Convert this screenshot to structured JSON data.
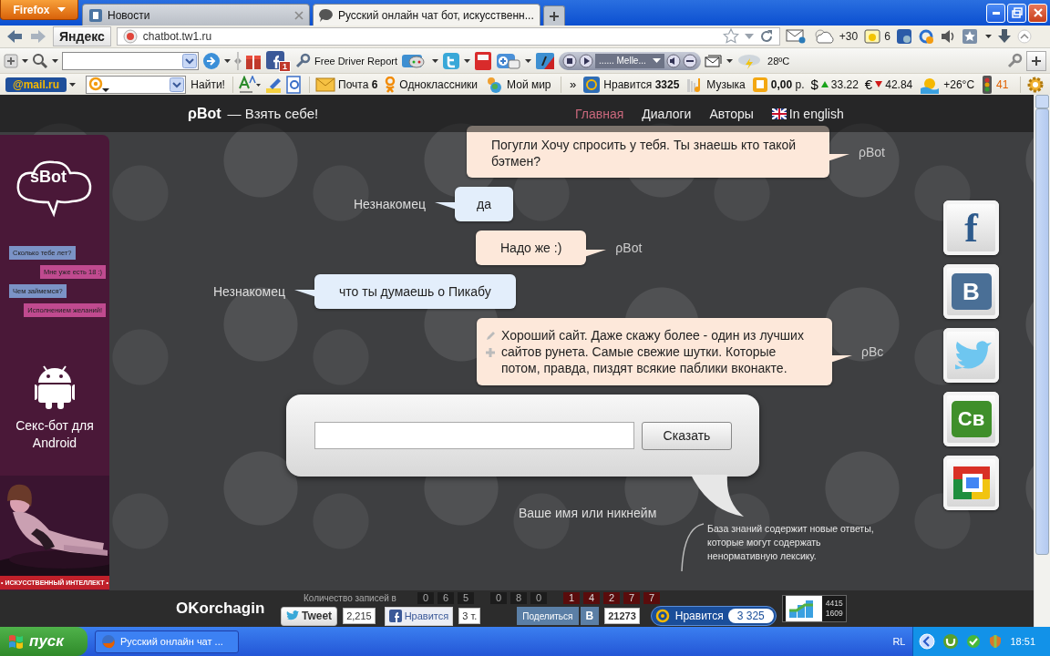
{
  "browser": {
    "menu_button": "Firefox",
    "tabs": [
      {
        "label": "Новости",
        "selected": false
      },
      {
        "label": "Русский онлайн чат бот, искусственн...",
        "selected": true
      }
    ],
    "search_logo": "Яндекс",
    "address": "chatbot.tw1.ru",
    "weather": "+30",
    "reminders": "6"
  },
  "toolbar": {
    "facebook_badge": "1",
    "driver_report": "Free Driver Report",
    "track": "...... Melle...",
    "temperature": "28ºC"
  },
  "mail_bar": {
    "logo": "@mail.ru",
    "search_button": "Найти!",
    "links": [
      {
        "kind": "mail",
        "label": "Почта **6**"
      },
      {
        "kind": "ok",
        "label": "Одноклассники"
      },
      {
        "kind": "world",
        "label": "Мой мир"
      }
    ],
    "more": "»",
    "informers": [
      {
        "kind": "like",
        "label": "Нравится **3325**"
      },
      {
        "kind": "music",
        "label": "Музыка"
      },
      {
        "kind": "wallet",
        "label": "**0,00** р."
      },
      {
        "kind": "currency_up",
        "symbol": "$",
        "label": "33.22"
      },
      {
        "kind": "currency_down",
        "symbol": "€",
        "label": "42.84"
      },
      {
        "kind": "weather",
        "label": "+26°C"
      },
      {
        "kind": "traffic",
        "label": "41"
      }
    ]
  },
  "site": {
    "brand": "ρBot",
    "tagline": "— Взять себе!",
    "nav": [
      {
        "kind": "page",
        "label": "Главная",
        "selected": true
      },
      {
        "kind": "page",
        "label": "Диалоги",
        "selected": false
      },
      {
        "kind": "page",
        "label": "Авторы",
        "selected": false
      },
      {
        "kind": "language",
        "label": "In english",
        "selected": false
      }
    ]
  },
  "promo": {
    "logo": "sBot",
    "chat": [
      {
        "kind": "question",
        "text": "Сколько тебе лет?"
      },
      {
        "kind": "answer",
        "text": "Мне уже есть 18 :)"
      },
      {
        "kind": "question",
        "text": "Чем займемся?"
      },
      {
        "kind": "answer",
        "text": "Исполнением желаний!"
      }
    ],
    "title": "Секс-бот для Android",
    "ribbon": "• ИСКУССТВЕННЫЙ ИНТЕЛЛЕКТ •"
  },
  "messages": [
    {
      "kind": "bot",
      "author": "ρBot",
      "text": "Погугли Хочу спросить у тебя. Ты знаешь кто такой бэтмен?",
      "tools": false
    },
    {
      "kind": "user",
      "author": "Незнакомец",
      "text": "да",
      "tools": false
    },
    {
      "kind": "bot",
      "author": "ρBot",
      "text": "Надо же :)",
      "tools": false
    },
    {
      "kind": "user",
      "author": "Незнакомец",
      "text": "что ты думаешь о Пикабу",
      "tools": false
    },
    {
      "kind": "bot",
      "author": "ρBc",
      "text": "Хороший сайт. Даже скажу более - один из лучших сайтов рунета. Самые свежие шутки. Которые потом, правда, пиздят всякие паблики вконакте.",
      "tools": true
    }
  ],
  "composer": {
    "button": "Сказать",
    "name_label": "Ваше имя или никнейм"
  },
  "notice": "База знаний содержит новые ответы, которые могут содержать ненормативную лексику.",
  "social": [
    {
      "kind": "facebook",
      "label": "f"
    },
    {
      "kind": "vk",
      "label": "B"
    },
    {
      "kind": "twitter"
    },
    {
      "kind": "cb",
      "label": "Св"
    },
    {
      "kind": "chrome"
    }
  ],
  "footer": {
    "author": "OKorchagin",
    "counter_caption": "Количество записей в",
    "digits": [
      {
        "kind": "dark",
        "value": "0"
      },
      {
        "kind": "dark",
        "value": "6"
      },
      {
        "kind": "dark",
        "value": "5"
      },
      {
        "kind": "gap"
      },
      {
        "kind": "dark",
        "value": "0"
      },
      {
        "kind": "dark",
        "value": "8"
      },
      {
        "kind": "dark",
        "value": "0"
      },
      {
        "kind": "gap"
      },
      {
        "kind": "red",
        "value": "1"
      },
      {
        "kind": "red",
        "value": "4"
      },
      {
        "kind": "red",
        "value": "2"
      },
      {
        "kind": "red",
        "value": "7"
      },
      {
        "kind": "red",
        "value": "7"
      }
    ],
    "tweet": {
      "label": "Tweet",
      "count": "2,215"
    },
    "facebook": {
      "label": "Нравится",
      "count": "3 т."
    },
    "vk": {
      "label": "Поделиться",
      "mark": "В",
      "count": "21273"
    },
    "mail": {
      "label": "Нравится",
      "count": "3 325"
    },
    "stats": [
      "4415",
      "1609"
    ]
  },
  "taskbar": {
    "start": "пуск",
    "tasks": [
      {
        "label": "Русский онлайн чат ...",
        "selected": false
      }
    ],
    "language": "RL",
    "clock": "18:51"
  }
}
